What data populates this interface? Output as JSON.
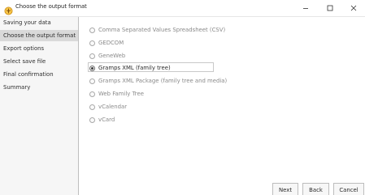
{
  "window": {
    "title": "Choose the output format",
    "controls": {
      "minimize": "–",
      "maximize": "☐",
      "close": "✕"
    }
  },
  "sidebar": {
    "items": [
      {
        "label": "Saving your data",
        "active": false
      },
      {
        "label": "Choose the output format",
        "active": true
      },
      {
        "label": "Export options",
        "active": false
      },
      {
        "label": "Select save file",
        "active": false
      },
      {
        "label": "Final confirmation",
        "active": false
      },
      {
        "label": "Summary",
        "active": false
      }
    ]
  },
  "formats": {
    "selected_index": 3,
    "options": [
      {
        "label": "Comma Separated Values Spreadsheet (CSV)"
      },
      {
        "label": "GEDCOM"
      },
      {
        "label": "GeneWeb"
      },
      {
        "label": "Gramps XML (family tree)"
      },
      {
        "label": "Gramps XML Package (family tree and media)"
      },
      {
        "label": "Web Family Tree"
      },
      {
        "label": "vCalendar"
      },
      {
        "label": "vCard"
      }
    ]
  },
  "buttons": {
    "next": "Next",
    "back": "Back",
    "cancel": "Cancel"
  },
  "colors": {
    "sidebar_bg": "#f6f6f6",
    "sidebar_active": "#d9d9d9",
    "text": "#2b2b2b",
    "option_dim": "#8a8a8a",
    "icon_accent": "#e0a020"
  },
  "icons": {
    "app": "gramps-tree-icon",
    "minimize": "minimize-icon",
    "maximize": "maximize-icon",
    "close": "close-icon"
  }
}
